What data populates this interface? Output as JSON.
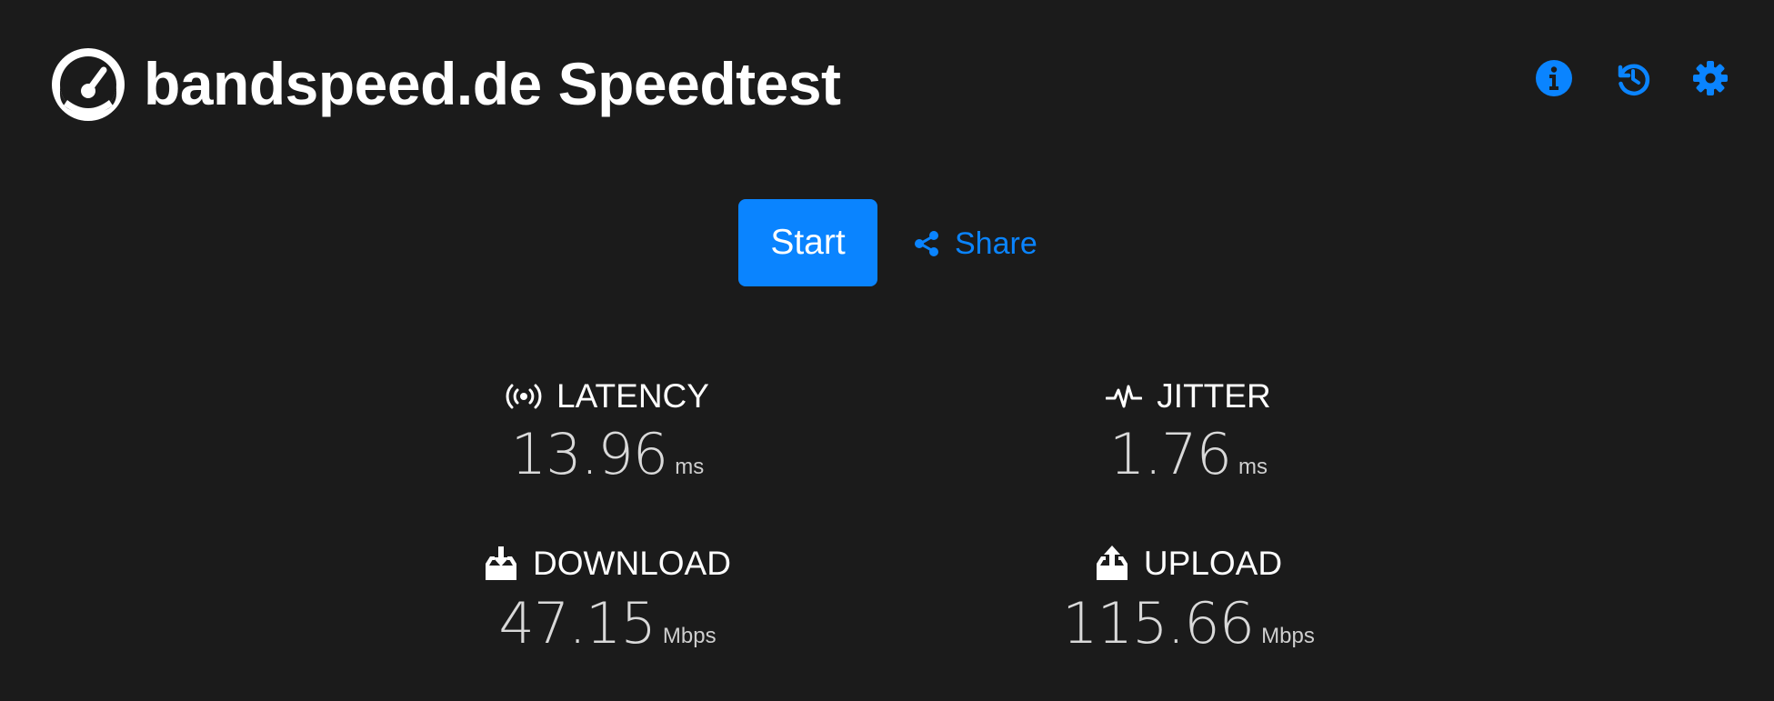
{
  "app": {
    "title": "bandspeed.de Speedtest",
    "logo_icon": "speedometer-icon"
  },
  "header_icons": [
    {
      "name": "info-icon",
      "color": "#0a84ff"
    },
    {
      "name": "history-icon",
      "color": "#0a84ff"
    },
    {
      "name": "gear-icon",
      "color": "#0a84ff"
    }
  ],
  "actions": {
    "start_label": "Start",
    "share_label": "Share",
    "share_icon": "share-icon"
  },
  "metrics": {
    "latency": {
      "label": "LATENCY",
      "value": "13.96",
      "unit": "ms",
      "icon": "broadcast-icon"
    },
    "jitter": {
      "label": "JITTER",
      "value": "1.76",
      "unit": "ms",
      "icon": "pulse-icon"
    },
    "download": {
      "label": "DOWNLOAD",
      "value": "47.15",
      "unit": "Mbps",
      "icon": "download-tray-icon"
    },
    "upload": {
      "label": "UPLOAD",
      "value": "115.66",
      "unit": "Mbps",
      "icon": "upload-tray-icon"
    }
  },
  "colors": {
    "background": "#1b1b1b",
    "accent": "#0a84ff",
    "text": "#ffffff"
  }
}
